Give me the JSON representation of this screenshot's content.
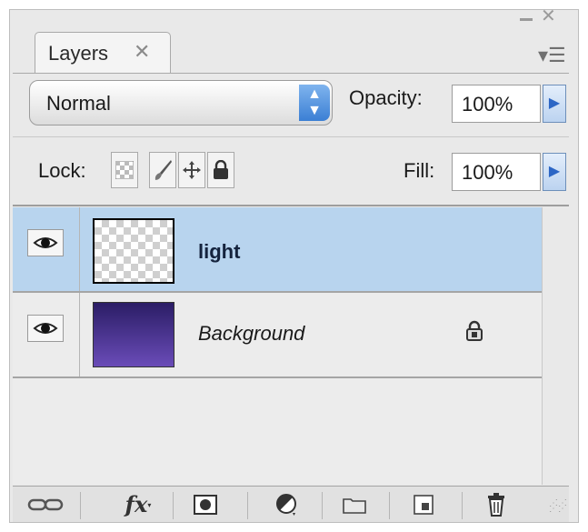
{
  "panel": {
    "tab_label": "Layers",
    "tab_close_icon": "close-icon",
    "menu_icon": "panel-menu-icon"
  },
  "blend_mode": {
    "selected": "Normal",
    "icon": "up-down-arrows-icon"
  },
  "opacity": {
    "label": "Opacity:",
    "value": "100%"
  },
  "lock": {
    "label": "Lock:",
    "buttons": [
      {
        "name": "lock-transparent-pixels",
        "icon": "checkerboard-icon"
      },
      {
        "name": "lock-image-pixels",
        "icon": "brush-icon"
      },
      {
        "name": "lock-position",
        "icon": "move-icon"
      },
      {
        "name": "lock-all",
        "icon": "lock-icon"
      }
    ]
  },
  "fill": {
    "label": "Fill:",
    "value": "100%"
  },
  "layers": [
    {
      "name": "light",
      "visible": true,
      "selected": true,
      "locked": false
    },
    {
      "name": "Background",
      "visible": true,
      "selected": false,
      "locked": true
    }
  ],
  "bottom_toolbar": [
    {
      "name": "link-layers",
      "icon": "link-icon"
    },
    {
      "name": "layer-style",
      "label": "fx"
    },
    {
      "name": "add-mask",
      "icon": "mask-icon"
    },
    {
      "name": "adjustment-layer",
      "icon": "half-circle-icon"
    },
    {
      "name": "new-group",
      "icon": "folder-icon"
    },
    {
      "name": "new-layer",
      "icon": "new-layer-icon"
    },
    {
      "name": "delete-layer",
      "icon": "trash-icon"
    }
  ],
  "colors": {
    "selection": "#b8d4ee",
    "accent": "#3b7fd4"
  }
}
